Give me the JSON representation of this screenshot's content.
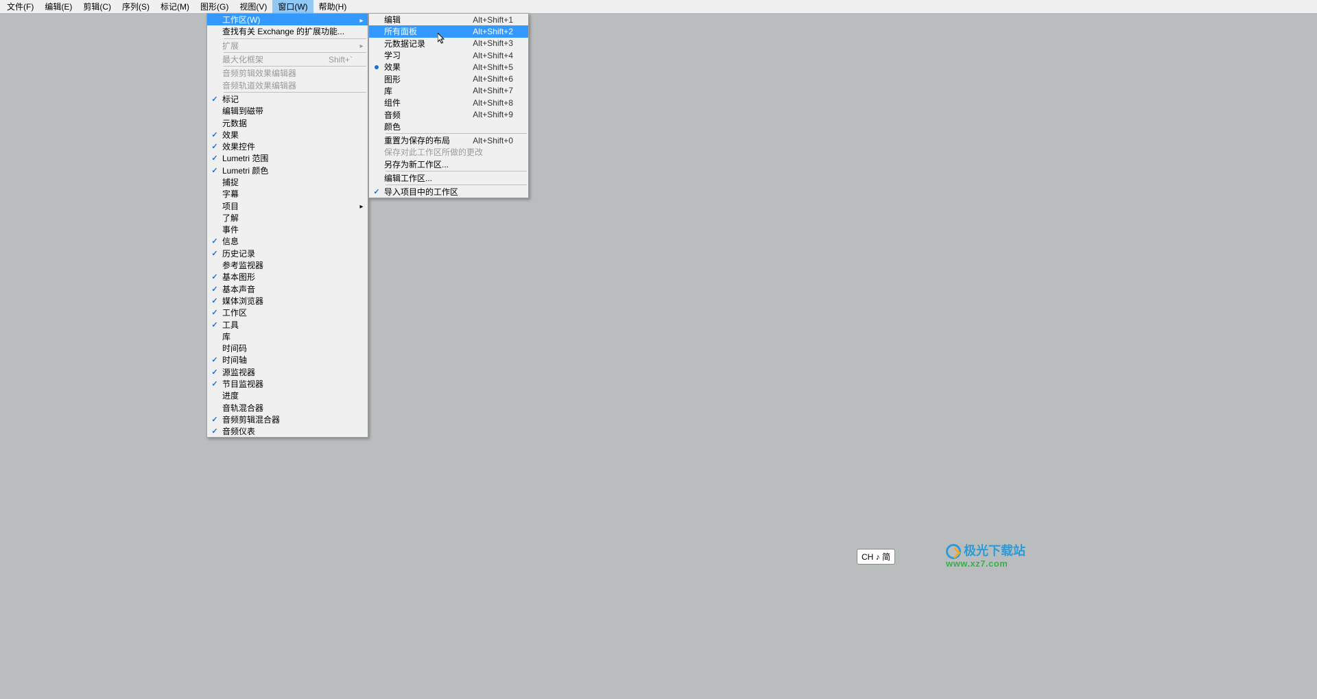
{
  "menubar": {
    "items": [
      {
        "label": "文件(F)"
      },
      {
        "label": "编辑(E)"
      },
      {
        "label": "剪辑(C)"
      },
      {
        "label": "序列(S)"
      },
      {
        "label": "标记(M)"
      },
      {
        "label": "图形(G)"
      },
      {
        "label": "视图(V)"
      },
      {
        "label": "窗口(W)"
      },
      {
        "label": "帮助(H)"
      }
    ],
    "activeIndex": 7
  },
  "mainDropdown": [
    {
      "type": "item",
      "label": "工作区(W)",
      "arrow": true,
      "highlight": true
    },
    {
      "type": "item",
      "label": "查找有关 Exchange 的扩展功能..."
    },
    {
      "type": "sep"
    },
    {
      "type": "item",
      "label": "扩展",
      "arrow": true,
      "disabled": true
    },
    {
      "type": "sep"
    },
    {
      "type": "item",
      "label": "最大化框架",
      "shortcut": "Shift+`",
      "disabled": true
    },
    {
      "type": "sep"
    },
    {
      "type": "item",
      "label": "音频剪辑效果编辑器",
      "disabled": true
    },
    {
      "type": "item",
      "label": "音频轨道效果编辑器",
      "disabled": true
    },
    {
      "type": "sep"
    },
    {
      "type": "item",
      "label": "标记",
      "checked": true
    },
    {
      "type": "item",
      "label": "编辑到磁带"
    },
    {
      "type": "item",
      "label": "元数据"
    },
    {
      "type": "item",
      "label": "效果",
      "checked": true
    },
    {
      "type": "item",
      "label": "效果控件",
      "checked": true
    },
    {
      "type": "item",
      "label": "Lumetri 范围",
      "checked": true
    },
    {
      "type": "item",
      "label": "Lumetri 颜色",
      "checked": true
    },
    {
      "type": "item",
      "label": "捕捉"
    },
    {
      "type": "item",
      "label": "字幕"
    },
    {
      "type": "item",
      "label": "项目",
      "arrow": true
    },
    {
      "type": "item",
      "label": "了解"
    },
    {
      "type": "item",
      "label": "事件"
    },
    {
      "type": "item",
      "label": "信息",
      "checked": true
    },
    {
      "type": "item",
      "label": "历史记录",
      "checked": true
    },
    {
      "type": "item",
      "label": "参考监视器"
    },
    {
      "type": "item",
      "label": "基本图形",
      "checked": true
    },
    {
      "type": "item",
      "label": "基本声音",
      "checked": true
    },
    {
      "type": "item",
      "label": "媒体浏览器",
      "checked": true
    },
    {
      "type": "item",
      "label": "工作区",
      "checked": true
    },
    {
      "type": "item",
      "label": "工具",
      "checked": true
    },
    {
      "type": "item",
      "label": "库"
    },
    {
      "type": "item",
      "label": "时间码"
    },
    {
      "type": "item",
      "label": "时间轴",
      "checked": true
    },
    {
      "type": "item",
      "label": "源监视器",
      "checked": true
    },
    {
      "type": "item",
      "label": "节目监视器",
      "checked": true
    },
    {
      "type": "item",
      "label": "进度"
    },
    {
      "type": "item",
      "label": "音轨混合器"
    },
    {
      "type": "item",
      "label": "音频剪辑混合器",
      "checked": true
    },
    {
      "type": "item",
      "label": "音频仪表",
      "checked": true
    }
  ],
  "subDropdown": [
    {
      "type": "item",
      "label": "编辑",
      "shortcut": "Alt+Shift+1"
    },
    {
      "type": "item",
      "label": "所有面板",
      "shortcut": "Alt+Shift+2",
      "highlight": true
    },
    {
      "type": "item",
      "label": "元数据记录",
      "shortcut": "Alt+Shift+3"
    },
    {
      "type": "item",
      "label": "学习",
      "shortcut": "Alt+Shift+4"
    },
    {
      "type": "item",
      "label": "效果",
      "shortcut": "Alt+Shift+5",
      "dot": true
    },
    {
      "type": "item",
      "label": "图形",
      "shortcut": "Alt+Shift+6"
    },
    {
      "type": "item",
      "label": "库",
      "shortcut": "Alt+Shift+7"
    },
    {
      "type": "item",
      "label": "组件",
      "shortcut": "Alt+Shift+8"
    },
    {
      "type": "item",
      "label": "音频",
      "shortcut": "Alt+Shift+9"
    },
    {
      "type": "item",
      "label": "颜色"
    },
    {
      "type": "sep"
    },
    {
      "type": "item",
      "label": "重置为保存的布局",
      "shortcut": "Alt+Shift+0"
    },
    {
      "type": "item",
      "label": "保存对此工作区所做的更改",
      "disabled": true
    },
    {
      "type": "item",
      "label": "另存为新工作区..."
    },
    {
      "type": "sep"
    },
    {
      "type": "item",
      "label": "编辑工作区..."
    },
    {
      "type": "sep"
    },
    {
      "type": "item",
      "label": "导入项目中的工作区",
      "checked": true
    }
  ],
  "ime": {
    "label": "CH ♪ 简"
  },
  "watermark": {
    "title": "极光下载站",
    "url": "www.xz7.com"
  }
}
